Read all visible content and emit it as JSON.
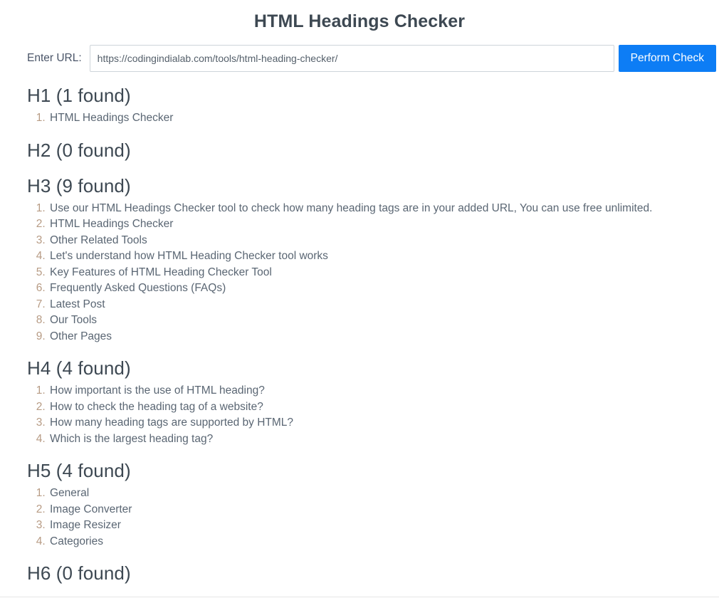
{
  "page": {
    "title": "HTML Headings Checker"
  },
  "form": {
    "label": "Enter URL:",
    "url_value": "https://codingindialab.com/tools/html-heading-checker/",
    "url_placeholder": "Enter URL",
    "submit_label": "Perform Check",
    "accent_color": "#0d7df5"
  },
  "results": {
    "groups": [
      {
        "title": "H1 (1 found)",
        "tag": "H1",
        "count": 1,
        "items": [
          "HTML Headings Checker"
        ]
      },
      {
        "title": "H2 (0 found)",
        "tag": "H2",
        "count": 0,
        "items": []
      },
      {
        "title": "H3 (9 found)",
        "tag": "H3",
        "count": 9,
        "items": [
          "Use our HTML Headings Checker tool to check how many heading tags are in your added URL, You can use free unlimited.",
          "HTML Headings Checker",
          "Other Related Tools",
          "Let's understand how HTML Heading Checker tool works",
          "Key Features of HTML Heading Checker Tool",
          "Frequently Asked Questions (FAQs)",
          "Latest Post",
          "Our Tools",
          "Other Pages"
        ]
      },
      {
        "title": "H4 (4 found)",
        "tag": "H4",
        "count": 4,
        "items": [
          "How important is the use of HTML heading?",
          "How to check the heading tag of a website?",
          "How many heading tags are supported by HTML?",
          "Which is the largest heading tag?"
        ]
      },
      {
        "title": "H5 (4 found)",
        "tag": "H5",
        "count": 4,
        "items": [
          "General",
          "Image Converter",
          "Image Resizer",
          "Categories"
        ]
      },
      {
        "title": "H6 (0 found)",
        "tag": "H6",
        "count": 0,
        "items": []
      }
    ]
  },
  "colors": {
    "heading_text": "#3d4852",
    "body_text": "#5a6673",
    "marker": "#b79b84",
    "input_border": "#ced4da",
    "divider": "#e6e6e6"
  }
}
